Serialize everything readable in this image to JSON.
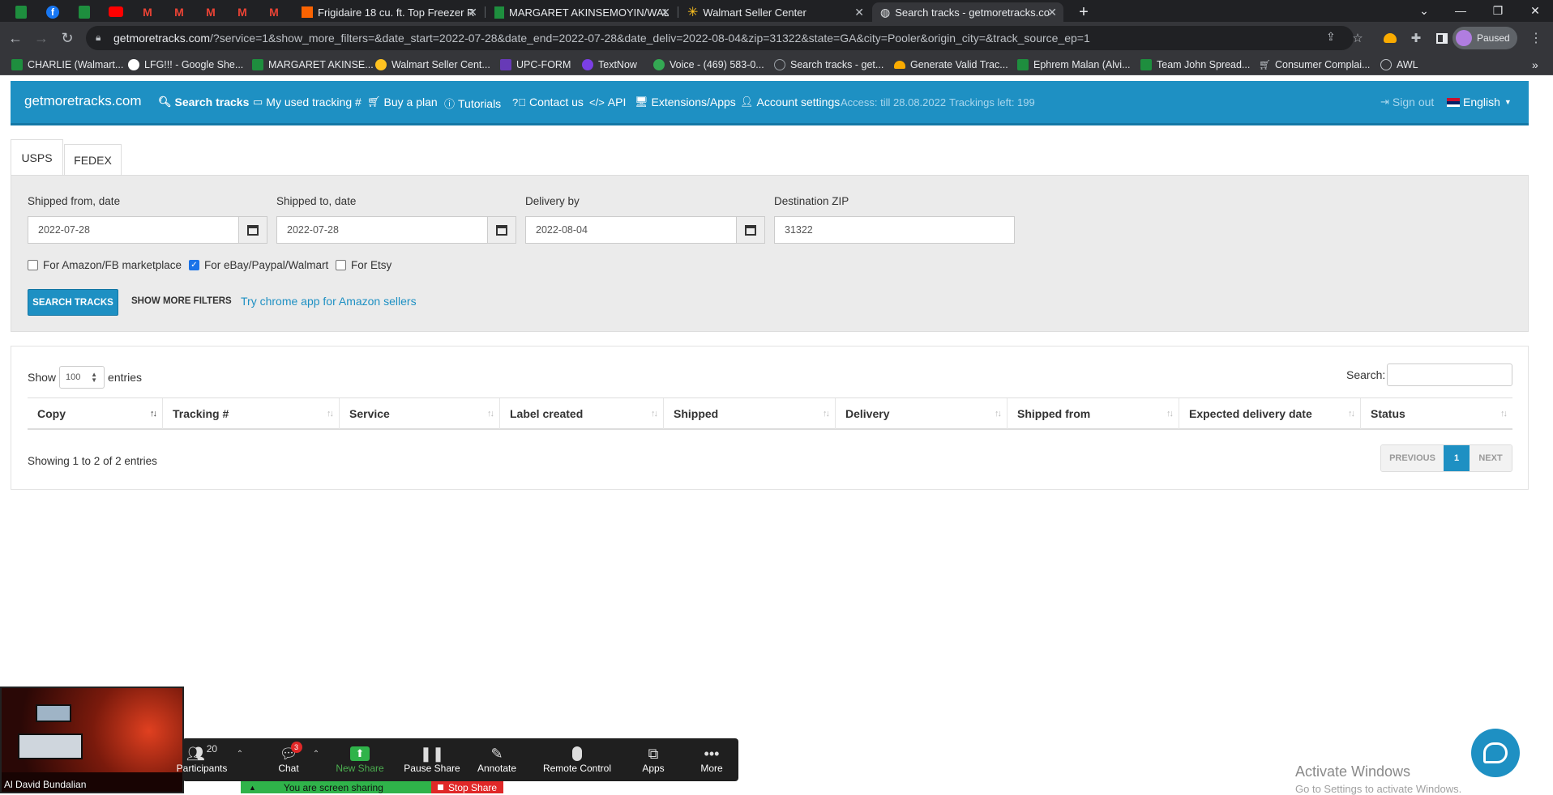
{
  "browser": {
    "tabs": [
      {
        "title": "Frigidaire 18 cu. ft. Top Freezer R",
        "icon": "home-depot-icon"
      },
      {
        "title": "MARGARET AKINSEMOYIN/WALI",
        "icon": "sheets-icon"
      },
      {
        "title": "Walmart Seller Center",
        "icon": "walmart-icon"
      },
      {
        "title": "Search tracks - getmoretracks.co",
        "icon": "globe-icon",
        "active": true
      }
    ],
    "url_domain": "getmoretracks.com",
    "url_path": "/?service=1&show_more_filters=&date_start=2022-07-28&date_end=2022-07-28&date_deliv=2022-08-04&zip=31322&state=GA&city=Pooler&origin_city=&track_source_ep=1",
    "profile_label": "Paused",
    "bookmarks": [
      {
        "label": "CHARLIE (Walmart...",
        "icon": "sheets-icon",
        "color": "#1e8e3e"
      },
      {
        "label": "LFG!!! - Google She...",
        "icon": "google-icon",
        "color": "#ffffff"
      },
      {
        "label": "MARGARET AKINSE...",
        "icon": "sheets-icon",
        "color": "#1e8e3e"
      },
      {
        "label": "Walmart Seller Cent...",
        "icon": "walmart-icon",
        "color": "#ffc220"
      },
      {
        "label": "UPC-FORM",
        "icon": "forms-icon",
        "color": "#673ab7"
      },
      {
        "label": "TextNow",
        "icon": "textnow-icon",
        "color": "#7b3fe4"
      },
      {
        "label": "Voice - (469) 583-0...",
        "icon": "voice-icon",
        "color": "#34a853"
      },
      {
        "label": "Search tracks - get...",
        "icon": "globe-icon",
        "color": "#9aa0a6"
      },
      {
        "label": "Generate Valid Trac...",
        "icon": "taco-icon",
        "color": "#f9ab00"
      },
      {
        "label": "Ephrem Malan (Alvi...",
        "icon": "sheets-icon",
        "color": "#1e8e3e"
      },
      {
        "label": "Team John Spread...",
        "icon": "sheets-icon",
        "color": "#1e8e3e"
      },
      {
        "label": "Consumer Complai...",
        "icon": "cart-icon",
        "color": "#bdc1c6"
      },
      {
        "label": "AWL",
        "icon": "globe-icon",
        "color": "#bdc1c6"
      }
    ]
  },
  "nav": {
    "brand": "getmoretracks.com",
    "items": [
      {
        "label": "Search tracks",
        "icon": "search-icon"
      },
      {
        "label": "My used tracking #",
        "icon": "inbox-icon"
      },
      {
        "label": "Buy a plan",
        "icon": "cart-icon"
      },
      {
        "label": "Tutorials",
        "icon": "info-icon"
      },
      {
        "label": "Contact us",
        "icon": "question-icon"
      },
      {
        "label": "API",
        "icon": "code-icon"
      },
      {
        "label": "Extensions/Apps",
        "icon": "monitor-icon"
      },
      {
        "label": "Account settings",
        "icon": "user-gear-icon"
      }
    ],
    "access": "Access: till 28.08.2022",
    "trackings_left": "Trackings left: 199",
    "sign_out": "Sign out",
    "language": "English"
  },
  "carrier_tabs": [
    "USPS",
    "FEDEX"
  ],
  "filters": {
    "shipped_from_label": "Shipped from, date",
    "shipped_from_value": "2022-07-28",
    "shipped_to_label": "Shipped to, date",
    "shipped_to_value": "2022-07-28",
    "delivery_by_label": "Delivery by",
    "delivery_by_value": "2022-08-04",
    "zip_label": "Destination ZIP",
    "zip_value": "31322",
    "checkboxes": [
      {
        "label": "For Amazon/FB marketplace",
        "checked": false
      },
      {
        "label": "For eBay/Paypal/Walmart",
        "checked": true
      },
      {
        "label": "For Etsy",
        "checked": false
      }
    ],
    "search_button": "SEARCH TRACKS",
    "more_filters_button": "SHOW MORE FILTERS",
    "chrome_app_link": "Try chrome app for Amazon sellers"
  },
  "results": {
    "show_label": "Show",
    "entries_label": "entries",
    "page_length": "100",
    "search_label": "Search:",
    "columns": [
      "Copy",
      "Tracking #",
      "Service",
      "Label created",
      "Shipped",
      "Delivery",
      "Shipped from",
      "Expected delivery date",
      "Status"
    ],
    "info": "Showing 1 to 2 of 2 entries",
    "pager": {
      "previous": "PREVIOUS",
      "current": "1",
      "next": "NEXT"
    }
  },
  "zoom": {
    "participants_count": "20",
    "participants_label": "Participants",
    "chat_label": "Chat",
    "chat_badge": "3",
    "new_share_label": "New Share",
    "pause_share_label": "Pause Share",
    "annotate_label": "Annotate",
    "remote_control_label": "Remote Control",
    "apps_label": "Apps",
    "more_label": "More",
    "sharing_text": "You are screen sharing",
    "stop_share": "Stop Share",
    "camera_name": "Al David Bundalian"
  },
  "windows_watermark": {
    "title": "Activate Windows",
    "subtitle": "Go to Settings to activate Windows."
  }
}
